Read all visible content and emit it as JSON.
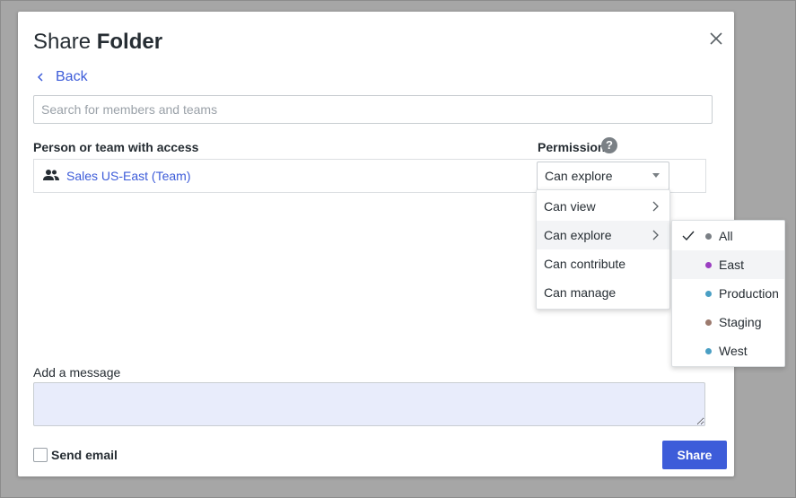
{
  "dialog": {
    "title_prefix": "Share",
    "title_bold": "Folder",
    "close_icon": "close-icon"
  },
  "back": {
    "label": "Back",
    "icon": "chevron-left-icon"
  },
  "search": {
    "value": "",
    "placeholder": "Search for members and teams"
  },
  "access_table": {
    "col_person": "Person or team with access",
    "col_permission": "Permission",
    "help_glyph": "?",
    "rows": [
      {
        "icon": "team-icon",
        "name": "Sales US-East (Team)",
        "permission": "Can explore"
      }
    ]
  },
  "permission_menu": {
    "items": [
      {
        "label": "Can view",
        "has_submenu": true
      },
      {
        "label": "Can explore",
        "has_submenu": true,
        "active": true
      },
      {
        "label": "Can contribute",
        "has_submenu": false
      },
      {
        "label": "Can manage",
        "has_submenu": false
      }
    ]
  },
  "model_submenu": {
    "items": [
      {
        "label": "All",
        "dot_color": "#7a7f85",
        "checked": true
      },
      {
        "label": "East",
        "dot_color": "#9b3fc1",
        "hover": true
      },
      {
        "label": "Production",
        "dot_color": "#4a9fc4"
      },
      {
        "label": "Staging",
        "dot_color": "#9c7a6e"
      },
      {
        "label": "West",
        "dot_color": "#4a9fc4"
      }
    ]
  },
  "message": {
    "label": "Add a message",
    "value": ""
  },
  "footer": {
    "send_email_label": "Send email",
    "send_email_checked": false,
    "share_label": "Share"
  },
  "colors": {
    "accent": "#3d5cd9",
    "overlay": "#a6a6a6",
    "message_bg": "#e8ecfb"
  }
}
